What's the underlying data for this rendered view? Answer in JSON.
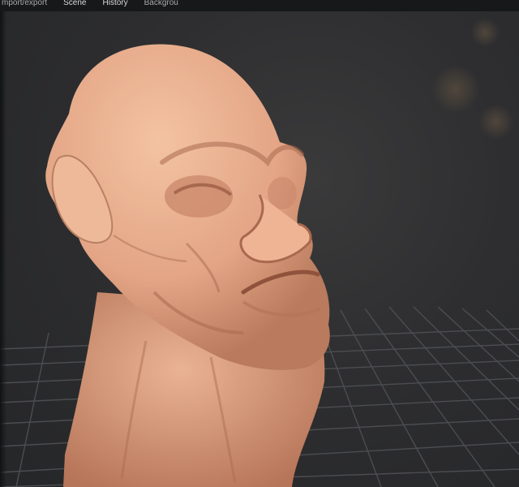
{
  "menu": {
    "items": [
      {
        "label": "mport/export",
        "clipped": true
      },
      {
        "label": "Scene"
      },
      {
        "label": "History"
      },
      {
        "label": "Backgrou",
        "clipped": true
      }
    ]
  },
  "viewport": {
    "object": "sculpted head bust",
    "skin_color": "#e6ad8c",
    "background_color": "#2e2e30",
    "grid_color": "#4b4d50",
    "show_grid": true
  }
}
